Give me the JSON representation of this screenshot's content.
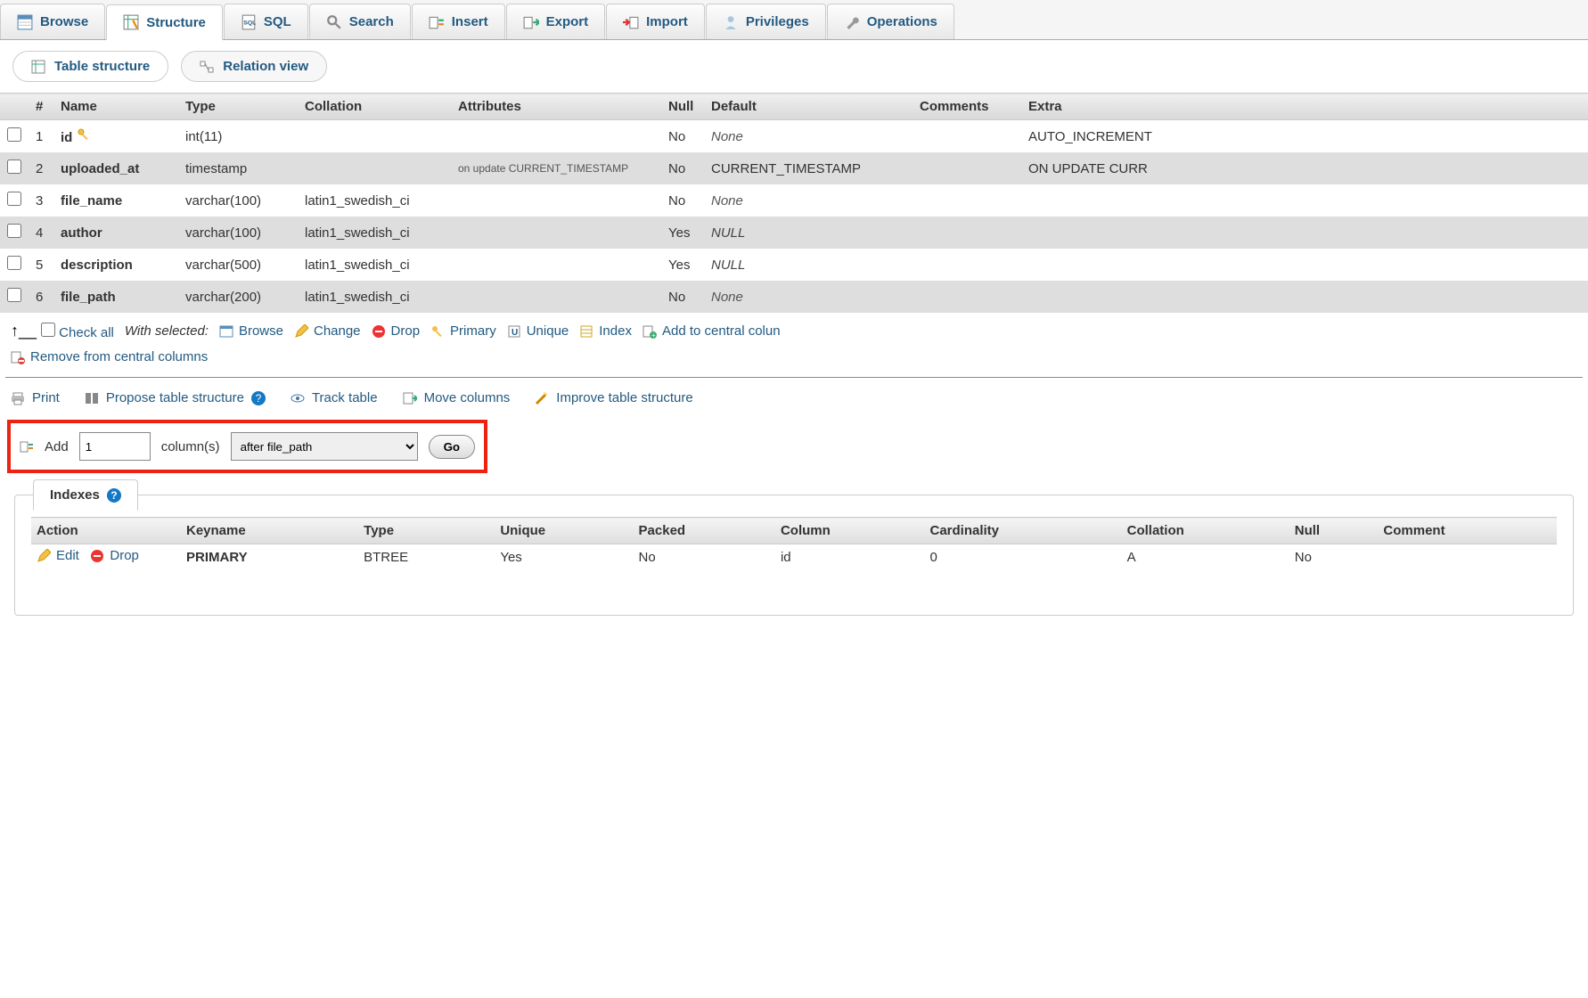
{
  "tabs": {
    "browse": "Browse",
    "structure": "Structure",
    "sql": "SQL",
    "search": "Search",
    "insert": "Insert",
    "export": "Export",
    "import": "Import",
    "privileges": "Privileges",
    "operations": "Operations"
  },
  "subtabs": {
    "table_structure": "Table structure",
    "relation_view": "Relation view"
  },
  "cols_header": {
    "num": "#",
    "name": "Name",
    "type": "Type",
    "collation": "Collation",
    "attributes": "Attributes",
    "null": "Null",
    "default": "Default",
    "comments": "Comments",
    "extra": "Extra"
  },
  "rows": [
    {
      "num": "1",
      "name": "id",
      "type": "int(11)",
      "collation": "",
      "attributes": "",
      "null": "No",
      "default": "None",
      "default_style": "none",
      "comments": "",
      "extra": "AUTO_INCREMENT",
      "pk": true
    },
    {
      "num": "2",
      "name": "uploaded_at",
      "type": "timestamp",
      "collation": "",
      "attributes": "on update CURRENT_TIMESTAMP",
      "null": "No",
      "default": "CURRENT_TIMESTAMP",
      "default_style": "plain",
      "comments": "",
      "extra": "ON UPDATE CURR"
    },
    {
      "num": "3",
      "name": "file_name",
      "type": "varchar(100)",
      "collation": "latin1_swedish_ci",
      "attributes": "",
      "null": "No",
      "default": "None",
      "default_style": "none",
      "comments": "",
      "extra": ""
    },
    {
      "num": "4",
      "name": "author",
      "type": "varchar(100)",
      "collation": "latin1_swedish_ci",
      "attributes": "",
      "null": "Yes",
      "default": "NULL",
      "default_style": "null",
      "comments": "",
      "extra": ""
    },
    {
      "num": "5",
      "name": "description",
      "type": "varchar(500)",
      "collation": "latin1_swedish_ci",
      "attributes": "",
      "null": "Yes",
      "default": "NULL",
      "default_style": "null",
      "comments": "",
      "extra": ""
    },
    {
      "num": "6",
      "name": "file_path",
      "type": "varchar(200)",
      "collation": "latin1_swedish_ci",
      "attributes": "",
      "null": "No",
      "default": "None",
      "default_style": "none",
      "comments": "",
      "extra": ""
    }
  ],
  "with_selected": {
    "check_all": "Check all",
    "label": "With selected:",
    "browse": "Browse",
    "change": "Change",
    "drop": "Drop",
    "primary": "Primary",
    "unique": "Unique",
    "index": "Index",
    "add_central": "Add to central colun",
    "remove_central": "Remove from central columns"
  },
  "tools": {
    "print": "Print",
    "propose": "Propose table structure",
    "track": "Track table",
    "move_cols": "Move columns",
    "improve": "Improve table structure"
  },
  "add_cols": {
    "add": "Add",
    "count": "1",
    "columns": "column(s)",
    "position": "after file_path",
    "go": "Go"
  },
  "indexes": {
    "title": "Indexes",
    "headers": {
      "action": "Action",
      "keyname": "Keyname",
      "type": "Type",
      "unique": "Unique",
      "packed": "Packed",
      "column": "Column",
      "cardinality": "Cardinality",
      "collation": "Collation",
      "null": "Null",
      "comment": "Comment"
    },
    "row": {
      "edit": "Edit",
      "drop": "Drop",
      "keyname": "PRIMARY",
      "type": "BTREE",
      "unique": "Yes",
      "packed": "No",
      "column": "id",
      "cardinality": "0",
      "collation": "A",
      "null": "No",
      "comment": ""
    }
  }
}
